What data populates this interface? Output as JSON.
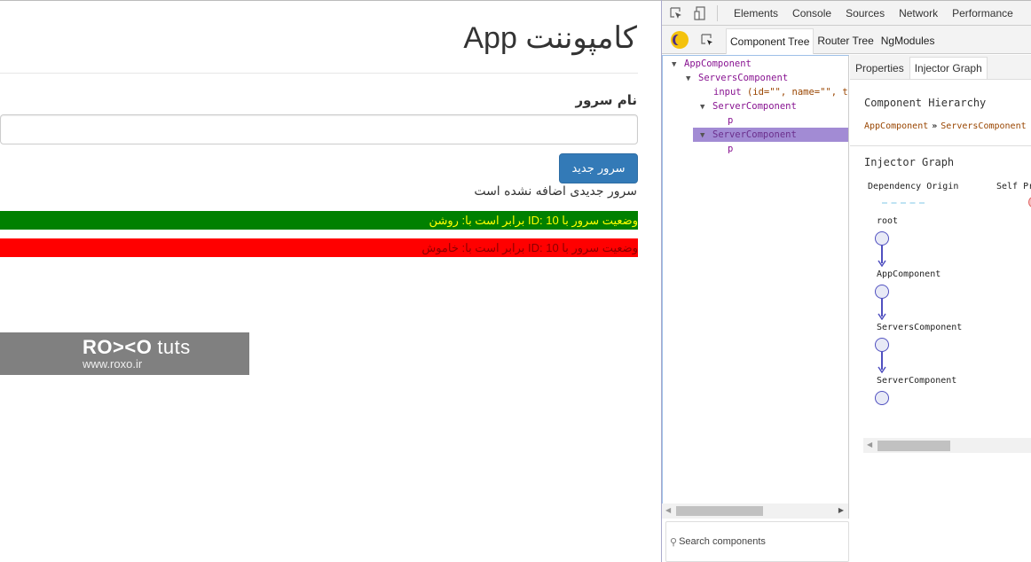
{
  "app": {
    "title": "کامپوننت App",
    "field_label": "نام سرور",
    "input_value": "",
    "add_button": "سرور جدید",
    "status_message": "سرور جدیدی اضافه نشده است",
    "servers": [
      {
        "text": "وضعیت سرور با ID: 10 برابر است با: روشن",
        "status": "online",
        "bg": "#008000",
        "fg": "#ffff00"
      },
      {
        "text": "وضعیت سرور با ID: 10 برابر است با: خاموش",
        "status": "offline",
        "bg": "#ff0000",
        "fg": "#8b0000"
      }
    ]
  },
  "watermark": {
    "logo": "RO><O",
    "logo_suffix": "tuts",
    "url": "www.roxo.ir"
  },
  "devtools": {
    "tabs": [
      "Elements",
      "Console",
      "Sources",
      "Network",
      "Performance"
    ],
    "augury_tabs": [
      "Component Tree",
      "Router Tree",
      "NgModules"
    ],
    "active_augury_tab": "Component Tree",
    "tree": [
      {
        "name": "AppComponent",
        "depth": 0,
        "expandable": true
      },
      {
        "name": "ServersComponent",
        "depth": 1,
        "expandable": true
      },
      {
        "element": "input",
        "attrs": "(id=\"\", name=\"\", typ",
        "depth": 2,
        "expandable": false
      },
      {
        "name": "ServerComponent",
        "depth": 2,
        "expandable": true
      },
      {
        "element": "p",
        "depth": 3,
        "expandable": false
      },
      {
        "name": "ServerComponent",
        "depth": 2,
        "expandable": true,
        "selected": true
      },
      {
        "element": "p",
        "depth": 3,
        "expandable": false
      }
    ],
    "search_placeholder": "Search components",
    "detail_tabs": [
      "Properties",
      "Injector Graph"
    ],
    "active_detail_tab": "Injector Graph",
    "component_hierarchy_title": "Component Hierarchy",
    "hierarchy": [
      "AppComponent",
      "ServersComponent"
    ],
    "hierarchy_separator": "»",
    "injector_graph_title": "Injector Graph",
    "legend": {
      "dependency_origin": "Dependency Origin",
      "self_provided": "Self Pr"
    },
    "graph_nodes": [
      "root",
      "AppComponent",
      "ServersComponent",
      "ServerComponent"
    ]
  }
}
